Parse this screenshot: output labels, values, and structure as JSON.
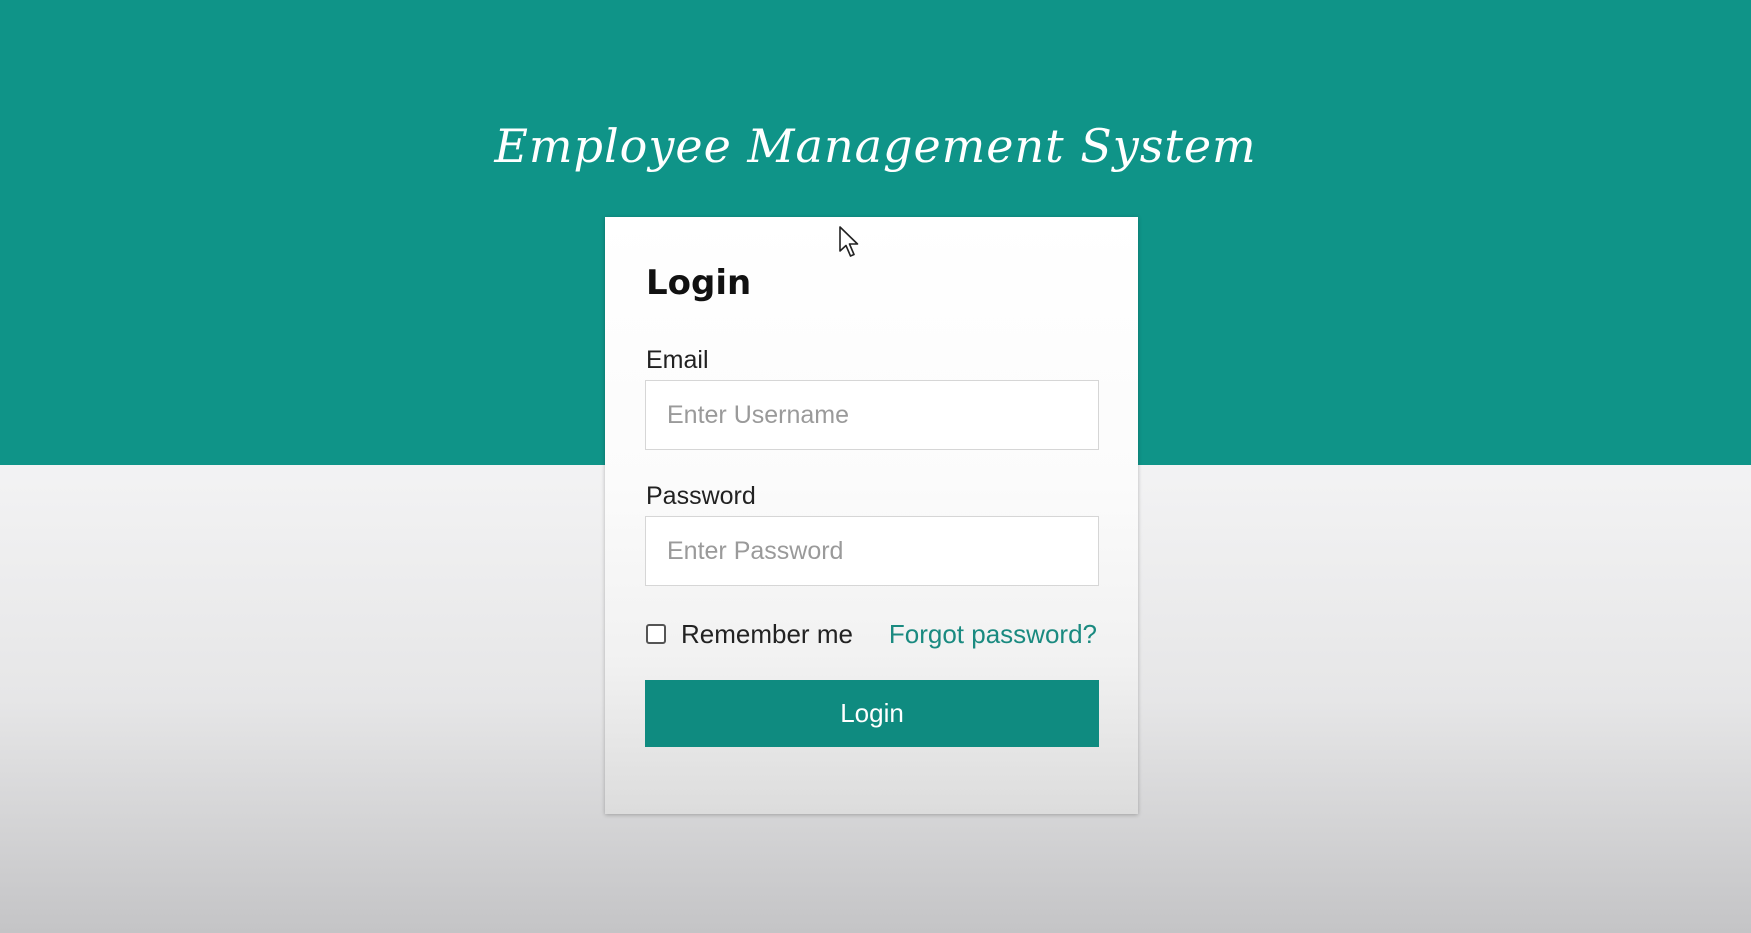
{
  "app": {
    "title": "Employee Management System"
  },
  "login_card": {
    "heading": "Login",
    "email": {
      "label": "Email",
      "placeholder": "Enter Username",
      "value": ""
    },
    "password": {
      "label": "Password",
      "placeholder": "Enter Password",
      "value": ""
    },
    "remember_me": {
      "label": "Remember me",
      "checked": false
    },
    "forgot_password_label": "Forgot password?",
    "submit_label": "Login"
  },
  "colors": {
    "brand_teal": "#0f9488",
    "button_teal": "#0f8b80",
    "link_teal": "#1a8a80"
  },
  "icons": {
    "cursor": "mouse-pointer-icon"
  }
}
